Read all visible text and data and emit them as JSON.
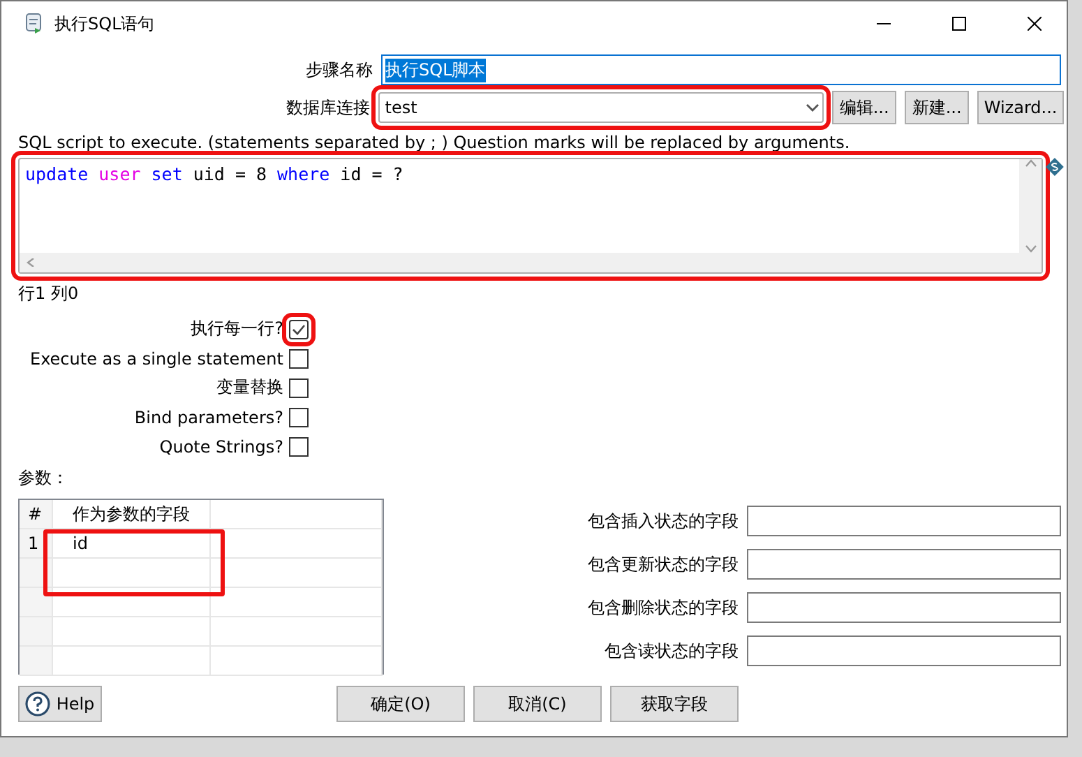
{
  "window": {
    "title": "执行SQL语句"
  },
  "step_name": {
    "label": "步骤名称",
    "value": "执行SQL脚本",
    "highlighted": false
  },
  "connection": {
    "label": "数据库连接",
    "value": "test",
    "highlighted": true,
    "buttons": [
      "编辑...",
      "新建...",
      "Wizard..."
    ]
  },
  "sql": {
    "description": "SQL script to execute. (statements separated by ; ) Question marks will be replaced by arguments.",
    "highlighted": true,
    "tokens": [
      {
        "text": "update",
        "kind": "keyword"
      },
      {
        "text": "user",
        "kind": "reserved"
      },
      {
        "text": "set",
        "kind": "keyword"
      },
      {
        "text": "uid = 8",
        "kind": "plain"
      },
      {
        "text": "where",
        "kind": "keyword"
      },
      {
        "text": "id = ?",
        "kind": "plain"
      }
    ]
  },
  "cursor_position": "行1 列0",
  "options": [
    {
      "label": "执行每一行?",
      "checked": true,
      "highlighted": true
    },
    {
      "label": "Execute as a single statement",
      "checked": false,
      "highlighted": false
    },
    {
      "label": "变量替换",
      "checked": false,
      "highlighted": false
    },
    {
      "label": "Bind parameters?",
      "checked": false,
      "highlighted": false
    },
    {
      "label": "Quote Strings?",
      "checked": false,
      "highlighted": false
    }
  ],
  "parameters": {
    "label": "参数：",
    "highlighted": true,
    "columns": [
      "#",
      "作为参数的字段"
    ],
    "rows": [
      [
        "1",
        "id"
      ]
    ]
  },
  "status_fields": [
    {
      "label": "包含插入状态的字段"
    },
    {
      "label": "包含更新状态的字段"
    },
    {
      "label": "包含删除状态的字段"
    },
    {
      "label": "包含读状态的字段"
    }
  ],
  "buttons": {
    "help": "Help",
    "actions": [
      "确定(O)",
      "取消(C)",
      "获取字段"
    ]
  }
}
